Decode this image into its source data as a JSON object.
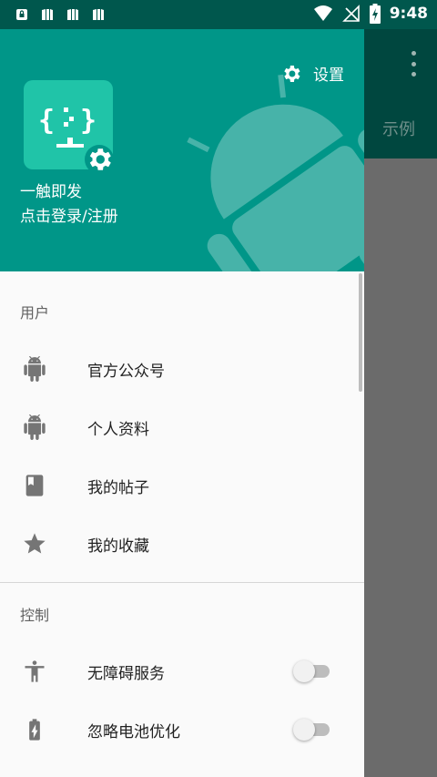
{
  "status_bar": {
    "time": "9:48",
    "left_icons": [
      "lock-notification-icon",
      "sim-notification-icon",
      "sim-notification-icon",
      "sim-notification-icon"
    ],
    "right_icons": [
      "wifi-icon",
      "no-signal-icon",
      "battery-charging-icon"
    ]
  },
  "background_app": {
    "tab_label": "示例",
    "toolbar_color": "#00473f"
  },
  "drawer": {
    "header_color": "#009688",
    "settings_label": "设置",
    "app_name": "一触即发",
    "login_label": "点击登录/注册",
    "logo_color": "#20c4a8",
    "sections": [
      {
        "title": "用户",
        "items": [
          {
            "label": "官方公众号",
            "icon": "android-icon"
          },
          {
            "label": "个人资料",
            "icon": "android-icon"
          },
          {
            "label": "我的帖子",
            "icon": "book-icon"
          },
          {
            "label": "我的收藏",
            "icon": "star-icon"
          }
        ]
      },
      {
        "title": "控制",
        "items": [
          {
            "label": "无障碍服务",
            "icon": "accessibility-icon",
            "toggle": false
          },
          {
            "label": "忽略电池优化",
            "icon": "battery-icon",
            "toggle": false
          }
        ]
      }
    ]
  }
}
